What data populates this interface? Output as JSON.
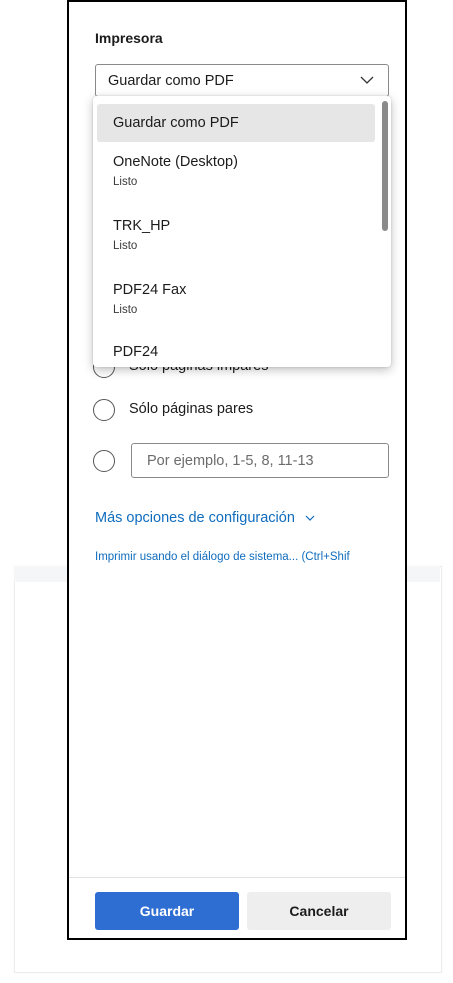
{
  "printer": {
    "label": "Impresora",
    "selected": "Guardar como PDF",
    "options": [
      {
        "name": "Guardar como PDF",
        "status": ""
      },
      {
        "name": "OneNote (Desktop)",
        "status": "Listo"
      },
      {
        "name": "TRK_HP",
        "status": "Listo"
      },
      {
        "name": "PDF24 Fax",
        "status": "Listo"
      },
      {
        "name": "PDF24",
        "status": ""
      }
    ]
  },
  "pages": {
    "odd_only": "Sólo páginas impares",
    "even_only": "Sólo páginas pares",
    "custom_placeholder": "Por ejemplo, 1-5, 8, 11-13"
  },
  "more_settings": "Más opciones de configuración",
  "system_dialog_link": "Imprimir usando el diálogo de sistema... (Ctrl+Shif",
  "buttons": {
    "save": "Guardar",
    "cancel": "Cancelar"
  },
  "colors": {
    "primary": "#2e6ed3",
    "link": "#0f6cbd"
  },
  "icons": {
    "select_chevron": "chevron-down-icon",
    "more_chevron": "chevron-down-icon"
  }
}
